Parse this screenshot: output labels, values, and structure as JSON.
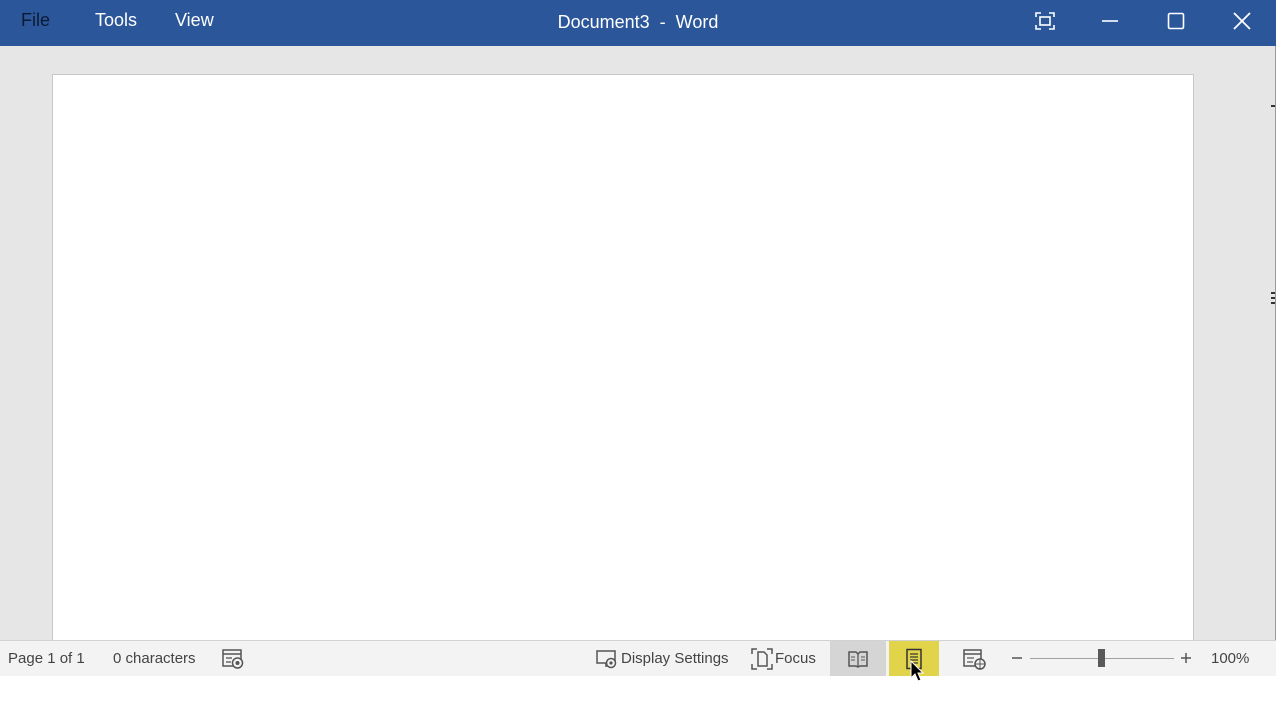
{
  "titlebar": {
    "menus": [
      "File",
      "Tools",
      "View"
    ],
    "title": "Document3  -  Word",
    "background_color": "#2b579a"
  },
  "window_controls": {
    "icons": [
      "fullscreen-icon",
      "minimize-icon",
      "maximize-icon",
      "close-icon"
    ]
  },
  "statusbar": {
    "page": "Page 1 of 1",
    "characters": "0 characters",
    "display_settings": "Display Settings",
    "focus": "Focus",
    "zoom_level": "100%",
    "zoom_value": 100,
    "active_view": "print-layout",
    "active_view_highlight": "#e2d44a"
  }
}
